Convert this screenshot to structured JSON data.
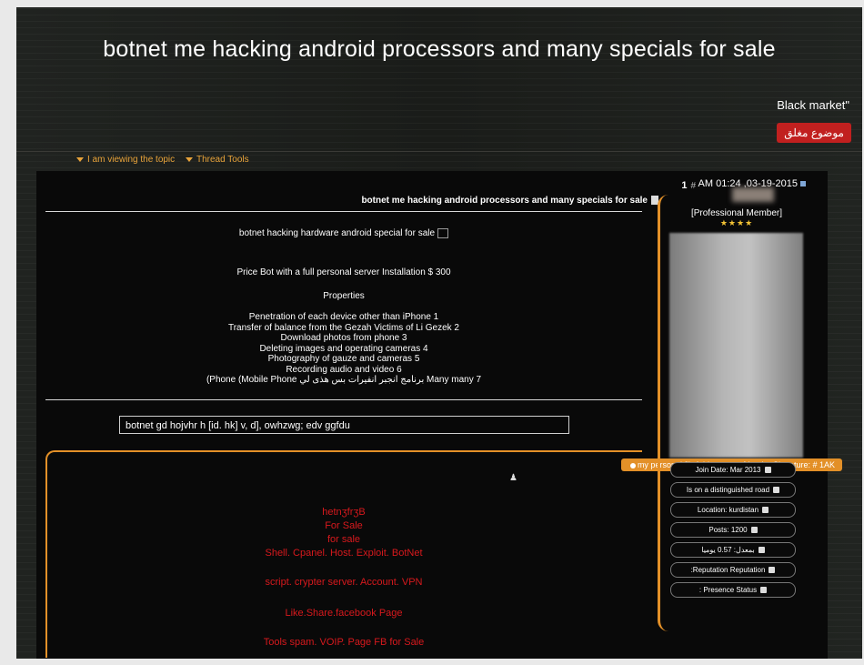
{
  "header": {
    "title": "botnet me hacking android processors and many specials for sale",
    "forum_name": "Black market\"",
    "closed_badge": "موضوع مغلق"
  },
  "toolbar": {
    "viewing_label": "I am viewing the topic",
    "thread_tools_label": "Thread Tools"
  },
  "post": {
    "number": "1",
    "hash": "#",
    "date": "AM 01:24 ,03-19-2015",
    "title": "botnet me hacking android processors and many specials for sale",
    "image_caption": "botnet hacking hardware android special for sale",
    "price_line": "Price Bot with a full personal server Installation $ 300",
    "properties_heading": "Properties",
    "properties": [
      "Penetration of each device other than iPhone 1",
      "Transfer of balance from the Gezah Victims of Li Gezek 2",
      "Download photos from phone 3",
      "Deleting images and operating cameras 4",
      "Photography of gauze and cameras 5",
      "Recording audio and video 6",
      "(Phone (Mobile Phone برنامج انجبر انفيرات بس هذى لي Many many 7"
    ],
    "signature_text": "botnet gd hojvhr h [id. hk] v, d], owhzwg; edv ggfdu"
  },
  "signature": {
    "bar_text": "my personal fileAdd me as a friend  ●  Signature: # 1AK",
    "lines": [
      "hetnʒfrʒB",
      "For Sale",
      "for sale",
      "Shell. Cpanel. Host. Exploit. BotNet",
      "script. crypter server. Account. VPN",
      "Like.Share.facebook Page",
      "Tools spam. VOIP. Page FB for Sale"
    ]
  },
  "user": {
    "title": "[Professional Member]",
    "stars": "★★★★",
    "join_date": "Join Date:  Mar 2013",
    "distinguished": "Is on a  distinguished road",
    "location": "Location:  kurdistan",
    "posts": "Posts:  1200",
    "rate": "بمعدل: 0.57 يوميا",
    "reputation": ":Reputation Reputation",
    "presence": ": Presence Status"
  },
  "colors": {
    "accent": "#e39028",
    "red_text": "#d8191d",
    "badge": "#c1201f"
  }
}
